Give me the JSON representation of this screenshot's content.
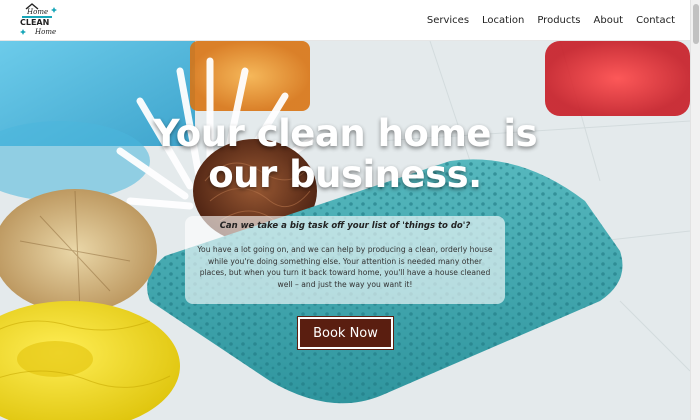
{
  "brand": {
    "logo_text_top": "Home",
    "logo_text_mid": "CLEAN",
    "logo_text_bottom": "Home",
    "colors": {
      "accent": "#5a1e10",
      "logo_teal": "#18a6b8"
    }
  },
  "nav": {
    "items": [
      {
        "label": "Services"
      },
      {
        "label": "Location"
      },
      {
        "label": "Products"
      },
      {
        "label": "About"
      },
      {
        "label": "Contact"
      }
    ]
  },
  "hero": {
    "headline": "Your clean home is our business.",
    "question": "Can we take a big task off your list of 'things to do'?",
    "paragraph": "You have a lot going on, and we can help by producing a clean, orderly house while you're doing something else. Your attention is needed many other places, but when you turn it back toward home, you'll have a house cleaned well – and just the way you want it!",
    "cta_label": "Book Now"
  }
}
